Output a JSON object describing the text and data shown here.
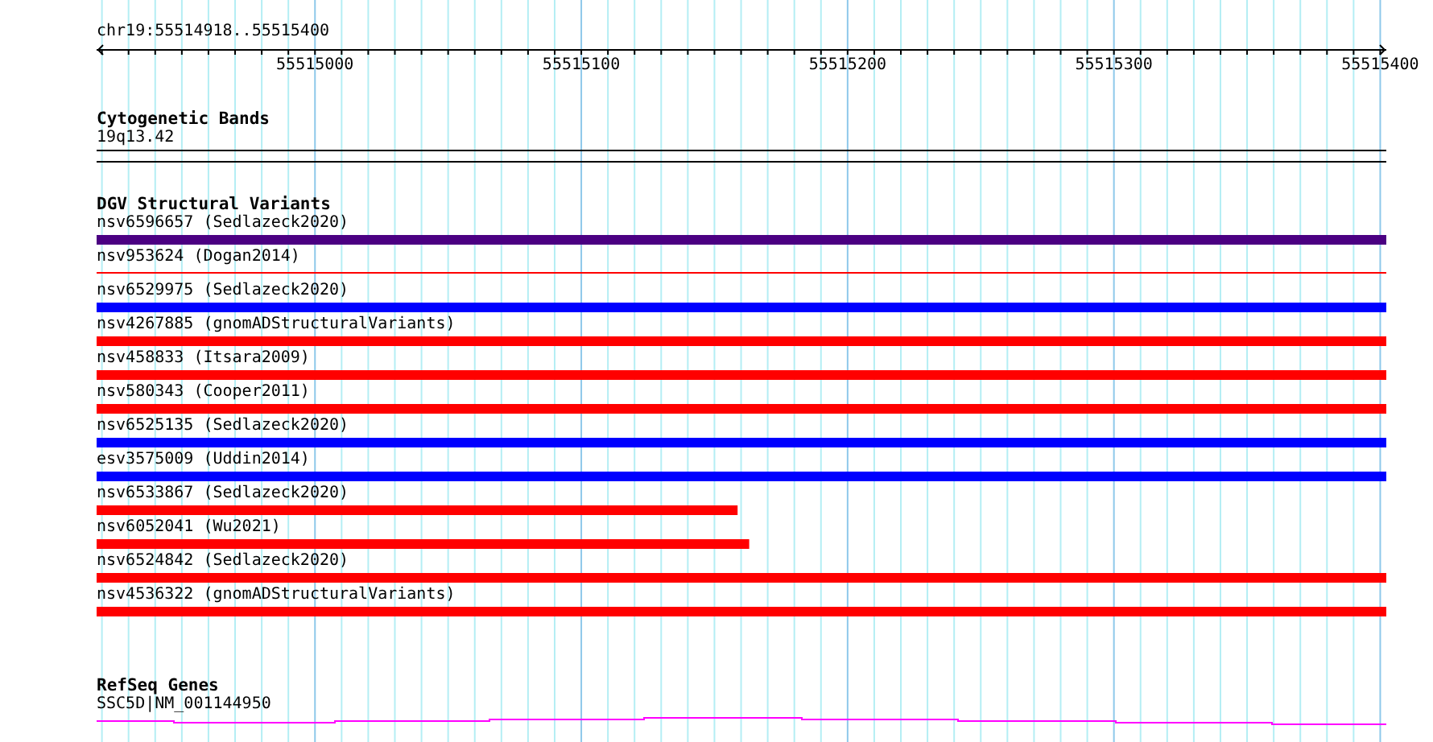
{
  "position": "chr19:55514918..55515400",
  "ruler": {
    "labels": [
      "55515000",
      "55515100",
      "55515200",
      "55515300",
      "55515400"
    ]
  },
  "tracks": [
    {
      "kind": "cytoband",
      "title": "Cytogenetic Bands",
      "items": [
        {
          "label": "19q13.42"
        }
      ]
    },
    {
      "kind": "variants",
      "title": "DGV Structural Variants",
      "items": [
        {
          "label": "nsv6596657 (Sedlazeck2020)",
          "kind": "bar",
          "color": "#4b0082",
          "level": 1
        },
        {
          "label": "nsv953624 (Dogan2014)",
          "kind": "line",
          "color": "#ff0000",
          "level": 1
        },
        {
          "label": "nsv6529975 (Sedlazeck2020)",
          "kind": "bar",
          "color": "#0000ff",
          "level": 1
        },
        {
          "label": "nsv4267885 (gnomADStructuralVariants)",
          "kind": "bar",
          "color": "#ff0000",
          "level": 1
        },
        {
          "label": "nsv458833 (Itsara2009)",
          "kind": "bar",
          "color": "#ff0000",
          "level": 1
        },
        {
          "label": "nsv580343 (Cooper2011)",
          "kind": "bar",
          "color": "#ff0000",
          "level": 1
        },
        {
          "label": "nsv6525135 (Sedlazeck2020)",
          "kind": "bar",
          "color": "#0000ff",
          "level": 1
        },
        {
          "label": "esv3575009 (Uddin2014)",
          "kind": "bar",
          "color": "#0000ff",
          "level": 1
        },
        {
          "label": "nsv6533867 (Sedlazeck2020)",
          "kind": "bar",
          "color": "#ff0000",
          "level": 0.497
        },
        {
          "label": "nsv6052041 (Wu2021)",
          "kind": "bar",
          "color": "#ff0000",
          "level": 0.506
        },
        {
          "label": "nsv6524842 (Sedlazeck2020)",
          "kind": "bar",
          "color": "#ff0000",
          "level": 1
        },
        {
          "label": "nsv4536322 (gnomADStructuralVariants)",
          "kind": "bar",
          "color": "#ff0000",
          "level": 1
        }
      ]
    },
    {
      "kind": "gene",
      "title": "RefSeq Genes",
      "items": [
        {
          "label": "SSC5D|NM_001144950",
          "color": "#ff00ff"
        }
      ]
    }
  ]
}
